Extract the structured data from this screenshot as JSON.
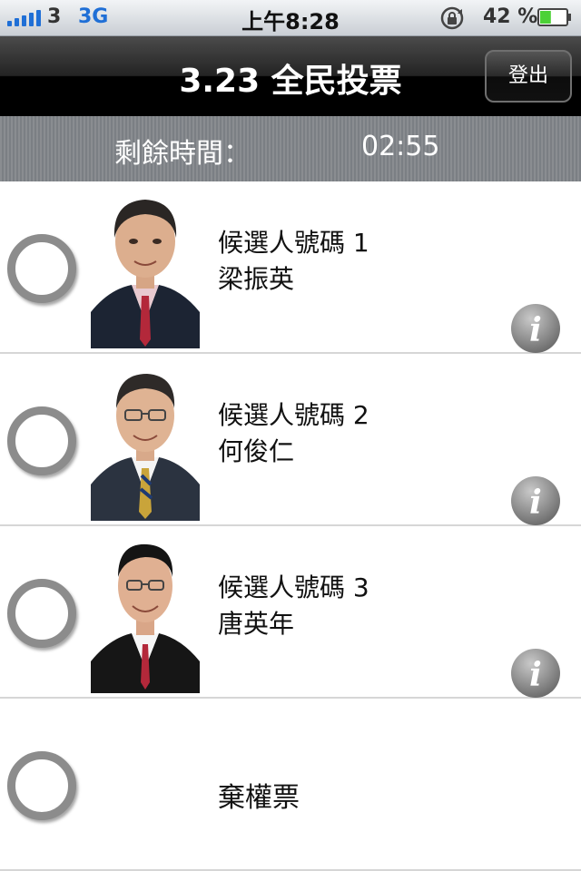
{
  "status_bar": {
    "carrier": "3",
    "network": "3G",
    "time": "上午8:28",
    "battery_percent": "42 %",
    "battery_level": 0.42,
    "signal_icon": "signal-bars-icon",
    "rotation_lock_icon": "rotation-lock-icon",
    "battery_icon": "battery-icon"
  },
  "nav": {
    "title": "3.23 全民投票",
    "logout_label": "登出"
  },
  "timer": {
    "label": "剩餘時間：",
    "value": "02:55"
  },
  "candidates": [
    {
      "number_label": "候選人號碼 1",
      "name": "梁振英"
    },
    {
      "number_label": "候選人號碼 2",
      "name": "何俊仁"
    },
    {
      "number_label": "候選人號碼 3",
      "name": "唐英年"
    }
  ],
  "abstain": {
    "label": "棄權票"
  },
  "colors": {
    "nav_bg": "#000000",
    "status_blue": "#1f6fd6",
    "battery_green": "#4cd137",
    "timer_bg": "#83868a"
  }
}
